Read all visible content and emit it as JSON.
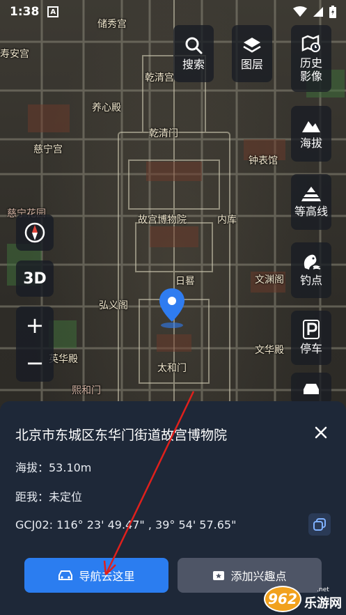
{
  "status_bar": {
    "time": "1:38",
    "a_badge": "A"
  },
  "map": {
    "labels": [
      "储秀宫",
      "寿安宫",
      "乾清宫",
      "养心殿",
      "乾清门",
      "慈宁宫",
      "钟表馆",
      "慈宁花园",
      "故宫博物院",
      "内库",
      "日晷",
      "文渊阁",
      "弘义阁",
      "英华殿",
      "文华殿",
      "熙和门",
      "太和门"
    ]
  },
  "tools_right": {
    "search": "搜索",
    "layers": "图层",
    "history": "历史影像",
    "elevation": "海拔",
    "contour": "等高线",
    "fishing": "钓点",
    "parking": "停车"
  },
  "tools_left": {
    "three_d": "3D",
    "zoom_in": "+",
    "zoom_out": "−"
  },
  "sheet": {
    "title": "北京市东城区东华门街道故宫博物院",
    "altitude": "海拔：53.10m",
    "distance": "距我：未定位",
    "coords": "GCJ02: 116° 23' 49.47\" , 39° 54' 57.65\"",
    "nav_label": "导航去这里",
    "poi_label": "添加兴趣点"
  },
  "watermark": {
    "badge": "962",
    "domain_suffix": ".net",
    "name": "乐游网"
  },
  "colors": {
    "sheet_bg": "#1e2838",
    "nav_button": "#2b7df0",
    "poi_button": "#4e5566",
    "marker": "#2f7cf0",
    "arrow": "#e0201c"
  }
}
